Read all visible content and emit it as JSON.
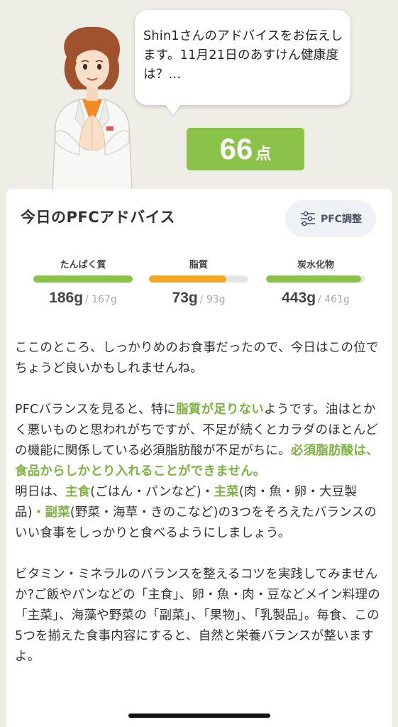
{
  "advisor": {
    "message": "Shin1さんのアドバイスをお伝えします。11月21日のあすけん健康度は？...",
    "score": "66",
    "score_unit": "点"
  },
  "pfc": {
    "title": "今日のPFCアドバイス",
    "adjust_button": "PFC調整",
    "macros": [
      {
        "name": "たんぱく質",
        "value": "186g",
        "target": "/ 167g",
        "fill": 1.0,
        "color": "#8bc34a"
      },
      {
        "name": "脂質",
        "value": "73g",
        "target": "/ 93g",
        "fill": 0.78,
        "color": "#f5a623"
      },
      {
        "name": "炭水化物",
        "value": "443g",
        "target": "/ 461g",
        "fill": 0.96,
        "color": "#8bc34a"
      }
    ]
  },
  "advice": {
    "p1": "ここのところ、しっかりめのお食事だったので、今日はこの位でちょうど良いかもしれませんね。",
    "p2_a": "PFCバランスを見ると、特に",
    "p2_hl1": "脂質が足りない",
    "p2_b": "ようです。油はとかく悪いものと思われがちですが、不足が続くとカラダのほとんどの機能に関係している必須脂肪酸が不足がちに。",
    "p2_hl2": "必須脂肪酸は、食品からしかとり入れることができません。",
    "p3_a": "明日は、",
    "p3_hl1": "主食",
    "p3_b": "(ごはん・パンなど)・",
    "p3_hl2": "主菜",
    "p3_c": "(肉・魚・卵・大豆製品)",
    "p3_hl3": "・副菜",
    "p3_d": "(野菜・海草・きのこなど)の3つをそろえたバランスのいい食事をしっかりと食べるようにしましょう。",
    "p4": "ビタミン・ミネラルのバランスを整えるコツを実践してみませんか?ご飯やパンなどの「主食」、卵・魚・肉・豆などメイン料理の「主菜」、海藻や野菜の「副菜」、「果物」、「乳製品」。毎食、この5つを揃えた食事内容にすると、自然と栄養バランスが整いますよ。"
  }
}
